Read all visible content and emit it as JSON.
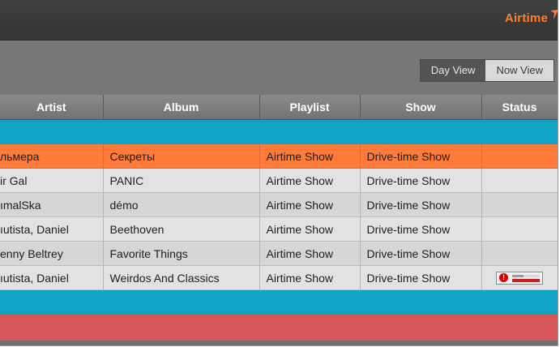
{
  "brand": {
    "name": "Airtime"
  },
  "view_toggle": {
    "day_view": "Day View",
    "now_view": "Now View"
  },
  "columns": [
    "Artist",
    "Album",
    "Playlist",
    "Show",
    "Status"
  ],
  "rows": [
    {
      "artist": "льмера",
      "album": "Секреты",
      "playlist": "Airtime Show",
      "show": "Drive-time Show",
      "state": "current"
    },
    {
      "artist": "ir Gal",
      "album": "PANIC",
      "playlist": "Airtime Show",
      "show": "Drive-time Show",
      "state": "normal"
    },
    {
      "artist": "ımalSka",
      "album": "démo",
      "playlist": "Airtime Show",
      "show": "Drive-time Show",
      "state": "normal"
    },
    {
      "artist": "ıutista, Daniel",
      "album": "Beethoven",
      "playlist": "Airtime Show",
      "show": "Drive-time Show",
      "state": "normal"
    },
    {
      "artist": "enny Beltrey",
      "album": "Favorite Things",
      "playlist": "Airtime Show",
      "show": "Drive-time Show",
      "state": "normal"
    },
    {
      "artist": "ıutista, Daniel",
      "album": "Weirdos And Classics",
      "playlist": "Airtime Show",
      "show": "Drive-time Show",
      "state": "warning"
    }
  ],
  "colors": {
    "accent": "#ff7e33",
    "current_row": "#ff7b3a",
    "show_separator": "#0fa3c6",
    "gap_row": "#d9575c",
    "warning": "#d40000"
  },
  "icons": {
    "status_warning": "warning-icon",
    "brand_mark": "airtime-logo-icon"
  }
}
